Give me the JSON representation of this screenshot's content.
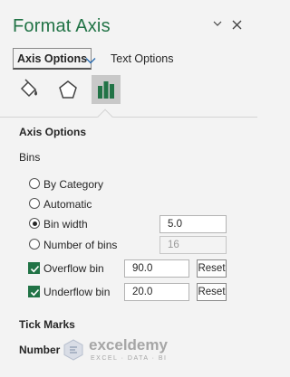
{
  "header": {
    "title": "Format Axis",
    "dropdown_icon": "chevron-down-icon",
    "close_icon": "close-icon"
  },
  "tabs": {
    "active": "Axis Options",
    "other": "Text Options"
  },
  "category_icons": [
    "paint-bucket-icon",
    "pentagon-icon",
    "bar-chart-icon"
  ],
  "axis_options": {
    "heading": "Axis Options",
    "bins_label": "Bins",
    "radios": [
      {
        "label": "By Category",
        "selected": false
      },
      {
        "label": "Automatic",
        "selected": false
      },
      {
        "label": "Bin width",
        "selected": true,
        "value": "5.0"
      },
      {
        "label": "Number of bins",
        "selected": false,
        "value": "16"
      }
    ],
    "overflow": {
      "label": "Overflow bin",
      "checked": true,
      "value": "90.0",
      "reset": "Reset"
    },
    "underflow": {
      "label": "Underflow bin",
      "checked": true,
      "value": "20.0",
      "reset": "Reset"
    }
  },
  "sections": {
    "tick_marks": "Tick Marks",
    "number": "Number"
  },
  "watermark": {
    "name": "exceldemy",
    "tagline": "EXCEL · DATA · BI"
  },
  "colors": {
    "accent": "#217346",
    "background": "#f3f3f3",
    "selected_tile": "#c8c8c8"
  }
}
